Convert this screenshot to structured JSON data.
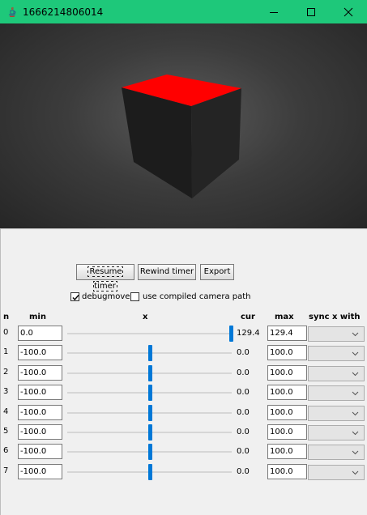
{
  "window": {
    "title": "1666214806014"
  },
  "controls": {
    "resume_label": "Resume timer",
    "rewind_label": "Rewind timer",
    "export_label": "Export",
    "debugmove_label": "debugmove",
    "debugmove_checked": true,
    "compiled_label": "use compiled camera path",
    "compiled_checked": false
  },
  "headers": {
    "n": "n",
    "min": "min",
    "x": "x",
    "cur": "cur",
    "max": "max",
    "sync": "sync x with"
  },
  "rows": [
    {
      "n": "0",
      "min": "0.0",
      "cur": "129.4",
      "max": "129.4",
      "slider_fraction": 1.0
    },
    {
      "n": "1",
      "min": "-100.0",
      "cur": "0.0",
      "max": "100.0",
      "slider_fraction": 0.5
    },
    {
      "n": "2",
      "min": "-100.0",
      "cur": "0.0",
      "max": "100.0",
      "slider_fraction": 0.5
    },
    {
      "n": "3",
      "min": "-100.0",
      "cur": "0.0",
      "max": "100.0",
      "slider_fraction": 0.5
    },
    {
      "n": "4",
      "min": "-100.0",
      "cur": "0.0",
      "max": "100.0",
      "slider_fraction": 0.5
    },
    {
      "n": "5",
      "min": "-100.0",
      "cur": "0.0",
      "max": "100.0",
      "slider_fraction": 0.5
    },
    {
      "n": "6",
      "min": "-100.0",
      "cur": "0.0",
      "max": "100.0",
      "slider_fraction": 0.5
    },
    {
      "n": "7",
      "min": "-100.0",
      "cur": "0.0",
      "max": "100.0",
      "slider_fraction": 0.5
    }
  ],
  "colors": {
    "titlebar": "#1ec87a",
    "cube_top": "#ff0000",
    "cube_sides": "#1f1f1f",
    "slider_thumb": "#0078d7"
  },
  "icons": [
    "java-app-icon",
    "minimize-icon",
    "maximize-icon",
    "close-icon",
    "checkmark-icon",
    "chevron-down-icon"
  ]
}
